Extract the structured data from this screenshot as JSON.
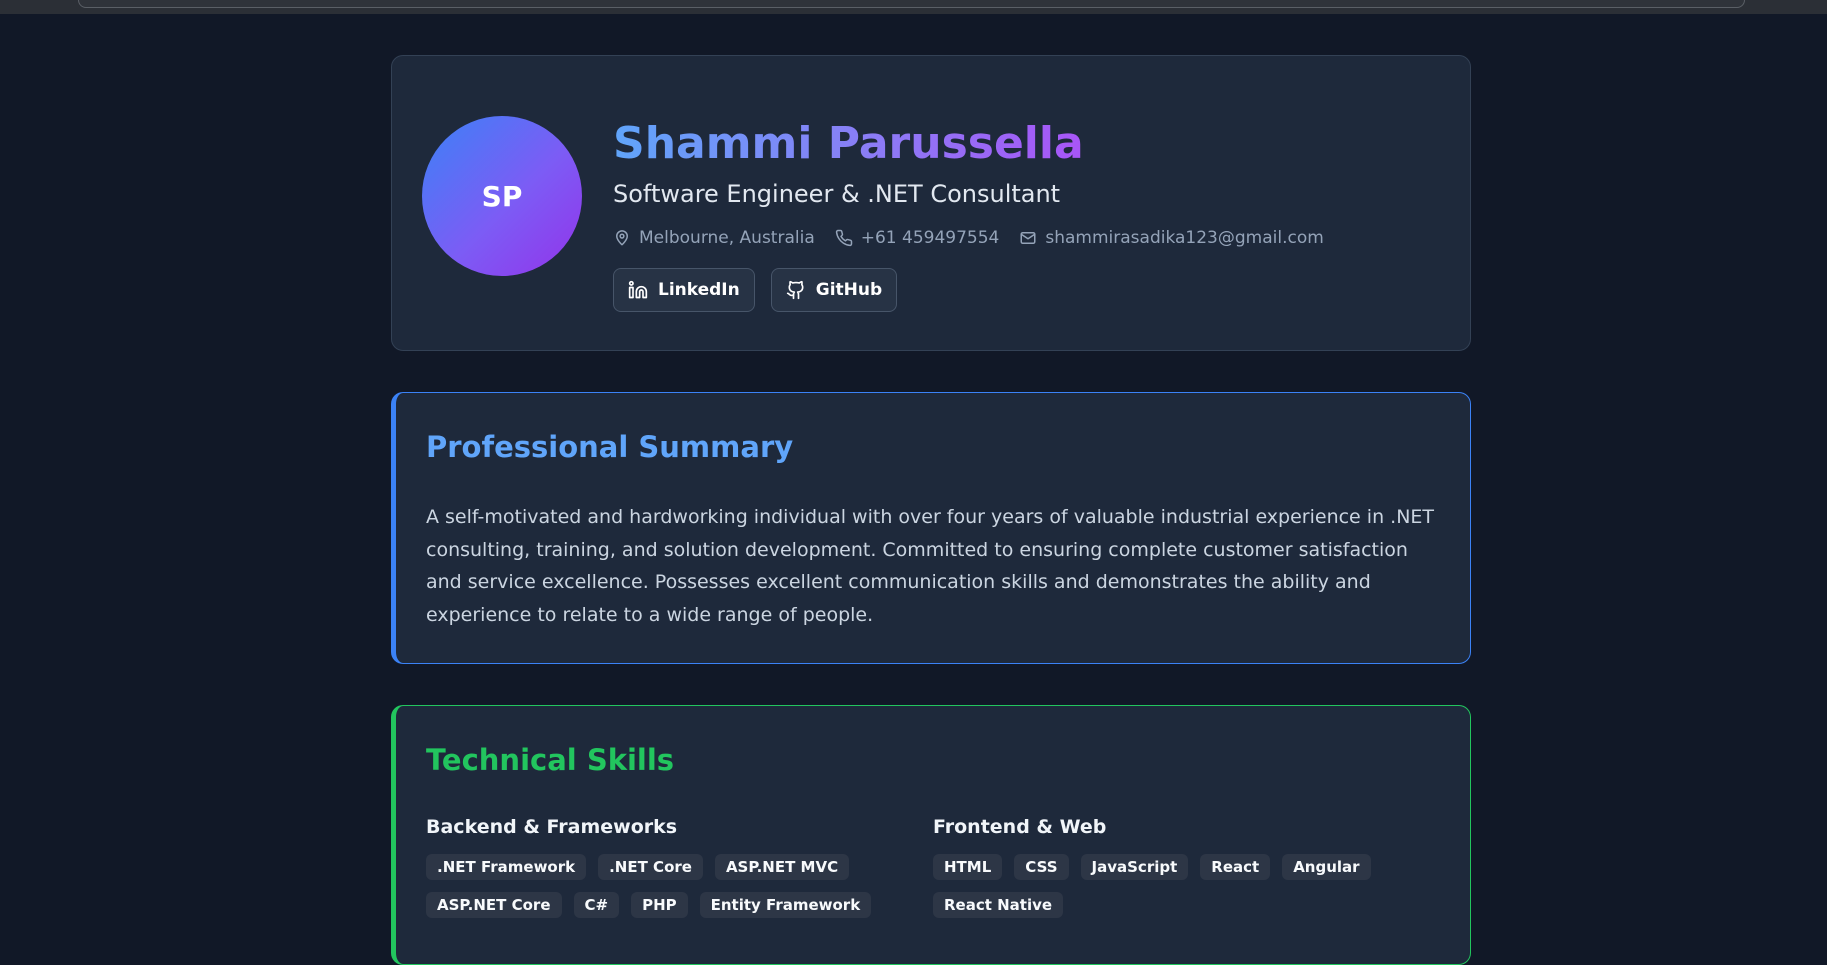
{
  "header": {
    "initials": "SP",
    "name": "Shammi Parussella",
    "title": "Software Engineer & .NET Consultant",
    "contacts": {
      "location": "Melbourne, Australia",
      "phone": "+61 459497554",
      "email": "shammirasadika123@gmail.com"
    },
    "links": [
      {
        "label": "LinkedIn",
        "icon": "linkedin-icon"
      },
      {
        "label": "GitHub",
        "icon": "github-icon"
      }
    ]
  },
  "summary": {
    "title": "Professional Summary",
    "text": "A self-motivated and hardworking individual with over four years of valuable industrial experience in .NET consulting, training, and solution development. Committed to ensuring complete customer satisfaction and service excellence. Possesses excellent communication skills and demonstrates the ability and experience to relate to a wide range of people."
  },
  "skills": {
    "title": "Technical Skills",
    "groups": [
      {
        "title": "Backend & Frameworks",
        "tags": [
          ".NET Framework",
          ".NET Core",
          "ASP.NET MVC",
          "ASP.NET Core",
          "C#",
          "PHP",
          "Entity Framework"
        ]
      },
      {
        "title": "Frontend & Web",
        "tags": [
          "HTML",
          "CSS",
          "JavaScript",
          "React",
          "Angular",
          "React Native"
        ]
      }
    ]
  },
  "colors": {
    "background": "#111827",
    "card": "#1e293b",
    "summary_accent": "#3b82f6",
    "skills_accent": "#22c55e",
    "name_gradient_start": "#60a5fa",
    "name_gradient_end": "#a855f7"
  }
}
